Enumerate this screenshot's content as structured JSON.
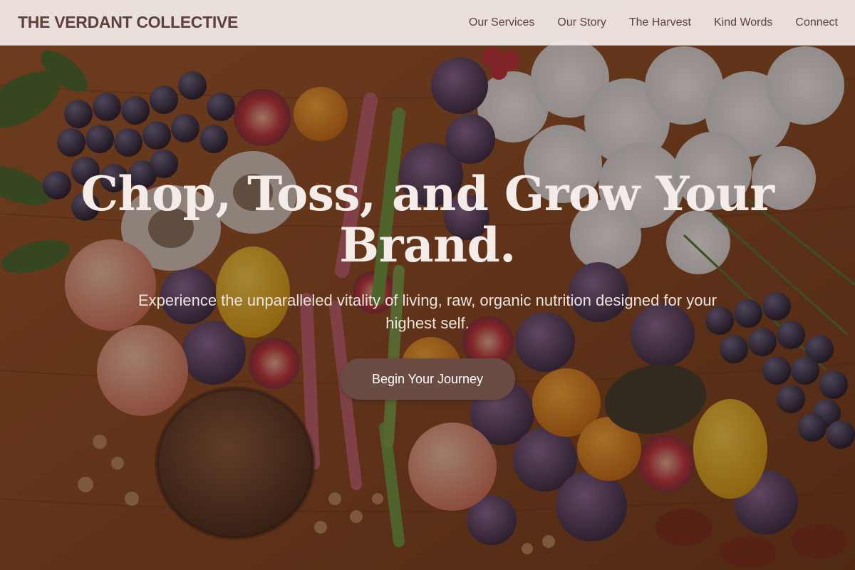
{
  "header": {
    "brand": "THE VERDANT COLLECTIVE",
    "nav": [
      {
        "label": "Our Services"
      },
      {
        "label": "Our Story"
      },
      {
        "label": "The Harvest"
      },
      {
        "label": "Kind Words"
      },
      {
        "label": "Connect"
      }
    ]
  },
  "hero": {
    "title": "Chop, Toss, and Grow Your Brand.",
    "subtitle": "Experience the unparalleled vitality of living, raw, organic nutrition designed for your highest self.",
    "cta_label": "Begin Your Journey",
    "background_image": "overhead-produce-photo"
  },
  "colors": {
    "brand_text": "#5e4139",
    "header_bg": "#f3ece9",
    "cta_bg": "#6b4c44",
    "hero_text": "#f3ece9"
  }
}
